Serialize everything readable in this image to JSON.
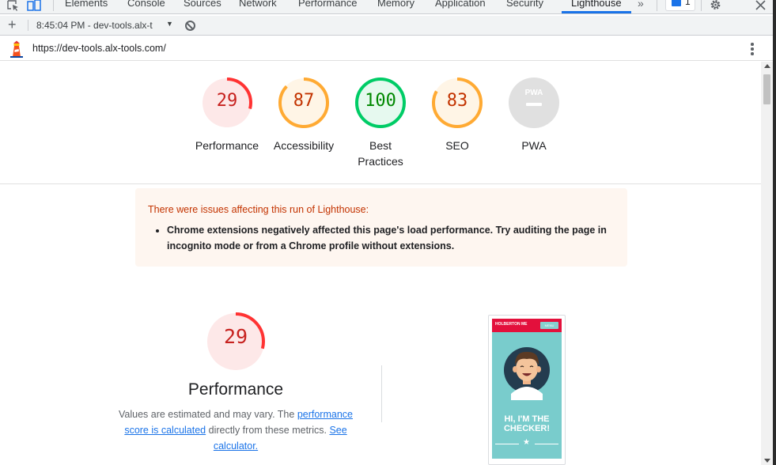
{
  "tabs": [
    {
      "label": "Elements"
    },
    {
      "label": "Console"
    },
    {
      "label": "Sources"
    },
    {
      "label": "Network"
    },
    {
      "label": "Performance"
    },
    {
      "label": "Memory"
    },
    {
      "label": "Application"
    },
    {
      "label": "Security"
    },
    {
      "label": "Lighthouse",
      "active": true
    }
  ],
  "more_tabs": "»",
  "issues_count": "1",
  "toolbar": {
    "add": "+",
    "report": "8:45:04 PM - dev-tools.alx-t",
    "caret": "▼"
  },
  "url": "https://dev-tools.alx-tools.com/",
  "gauges": [
    {
      "score": "29",
      "label": "Performance",
      "value": 0.29,
      "status": "fail"
    },
    {
      "score": "87",
      "label": "Accessibility",
      "value": 0.87,
      "status": "average"
    },
    {
      "score": "100",
      "label": "Best Practices",
      "value": 1.0,
      "status": "pass"
    },
    {
      "score": "83",
      "label": "SEO",
      "value": 0.83,
      "status": "average"
    },
    {
      "score": "",
      "label": "PWA",
      "value": 0,
      "status": "pwa"
    }
  ],
  "pwa_badge_text": "PWA",
  "warning": {
    "title": "There were issues affecting this run of Lighthouse:",
    "items": [
      "Chrome extensions negatively affected this page's load performance. Try auditing the page in incognito mode or from a Chrome profile without extensions."
    ]
  },
  "performance": {
    "score": "29",
    "value": 0.29,
    "title": "Performance",
    "desc_prefix": "Values are estimated and may vary. The ",
    "link1": "performance score is calculated",
    "desc_mid": " directly from these metrics. ",
    "link2": "See calculator."
  },
  "screenshot": {
    "brand": "HOLBERTON ME",
    "menu": "MENU",
    "headline_line1": "HI, I'M THE",
    "headline_line2": "CHECKER!",
    "star": "★"
  },
  "colors": {
    "fail": "#ff3333",
    "fail_text": "#c7221f",
    "fail_bg": "#fde8e8",
    "average": "#ffaa33",
    "average_text": "#c33300",
    "average_bg": "#fff5e6",
    "pass": "#00cc66",
    "pass_text": "#008800",
    "pass_bg": "#e6f9ef",
    "pwa_bg": "#e0e0e0",
    "accent": "#1a73e8"
  }
}
